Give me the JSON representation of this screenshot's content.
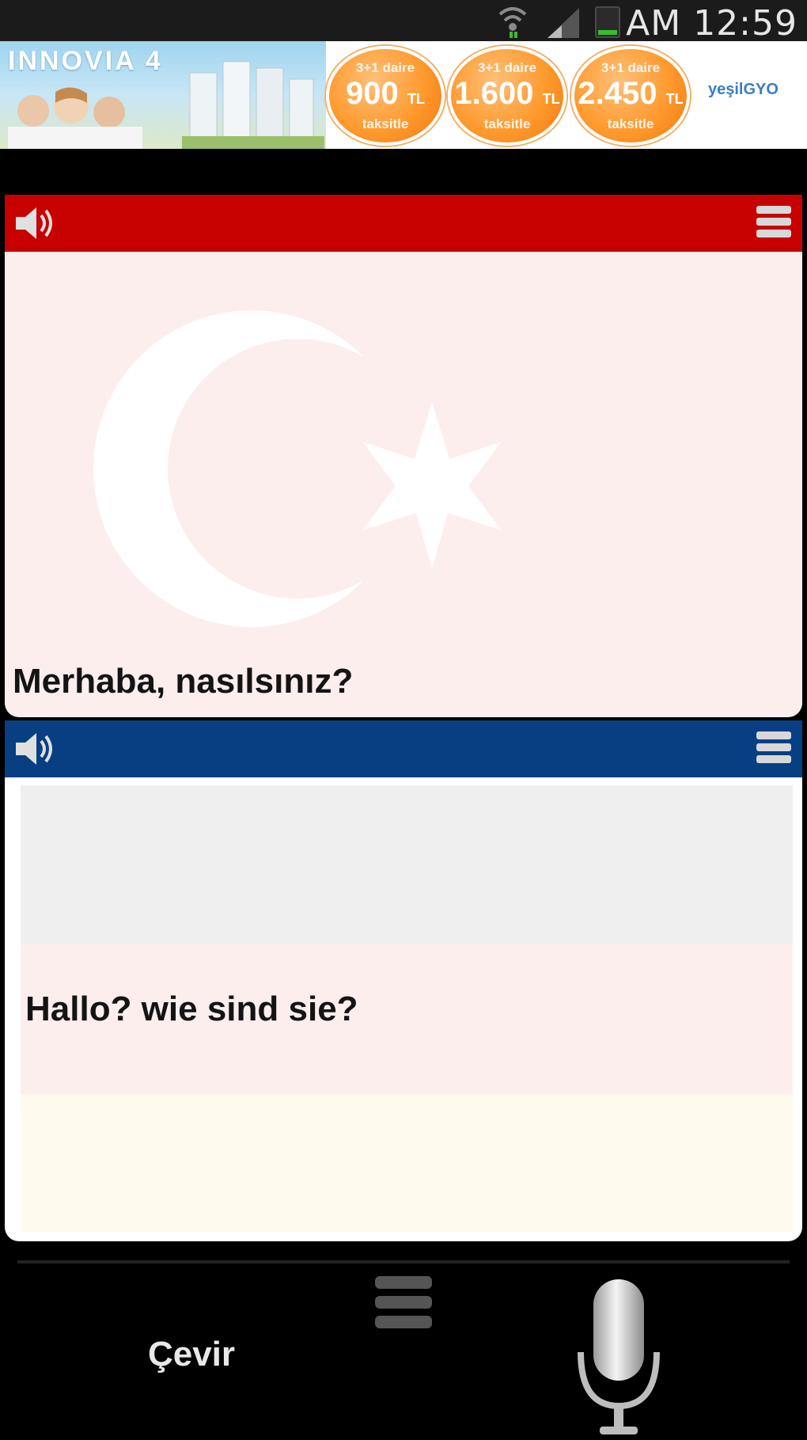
{
  "status_bar": {
    "time": "AM 12:59",
    "icons": [
      "wifi-icon",
      "signal-icon",
      "battery-icon"
    ]
  },
  "ad_banner": {
    "brand": "INNOVIA 4",
    "offers": [
      {
        "top": "3+1 daire",
        "amount": "900",
        "unit": "TL",
        "bottom": "taksitle"
      },
      {
        "top": "3+1 daire",
        "amount": "1.600",
        "unit": "TL",
        "bottom": "taksitle"
      },
      {
        "top": "3+1 daire",
        "amount": "2.450",
        "unit": "TL",
        "bottom": "taksitle"
      }
    ],
    "logo": "yeşilGYO"
  },
  "source_panel": {
    "language_flag": "turkey",
    "header_color": "#c70000",
    "text": "Merhaba, nasılsınız?",
    "icons": [
      "speaker-icon",
      "menu-icon"
    ]
  },
  "target_panel": {
    "language_flag": "germany",
    "header_color": "#073f82",
    "text": "Hallo? wie sind sie?",
    "icons": [
      "speaker-icon",
      "menu-icon"
    ]
  },
  "bottom_bar": {
    "translate_label": "Çevir",
    "icons": [
      "menu-icon",
      "microphone-icon"
    ]
  }
}
